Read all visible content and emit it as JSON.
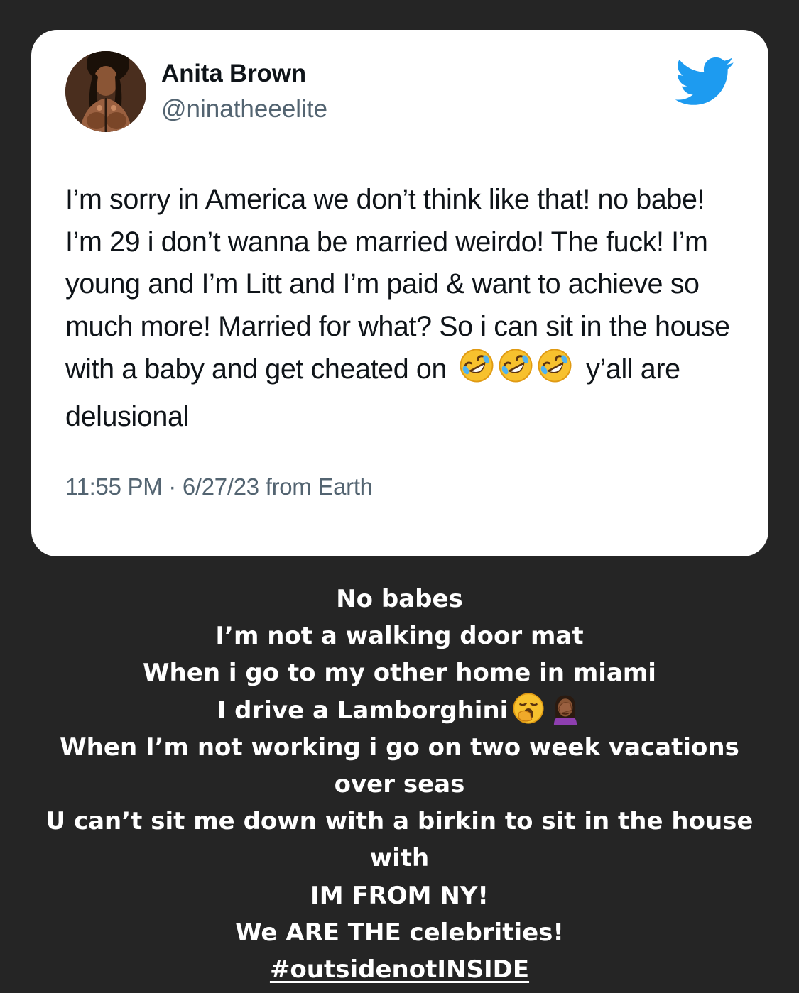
{
  "tweet": {
    "display_name": "Anita Brown",
    "handle": "@ninatheeelite",
    "avatar_icon": "profile-photo",
    "platform_icon": "twitter-bird-icon",
    "platform_color": "#1d9bf0",
    "text_part1": "I’m sorry in America we don’t think like that! no babe! I’m 29 i don’t wanna be married weirdo! The fuck! I’m young and I’m Litt and I’m paid & want to achieve so much more! Married for what? So i can sit in the house with a baby and get cheated on",
    "emoji": "rolling-on-floor-laughing-emoji",
    "emoji_count": 3,
    "text_part2": "y’all are delusional",
    "timestamp": "11:55 PM · 6/27/23 from Earth"
  },
  "caption": {
    "line1": "No babes",
    "line2": "I’m not a walking door mat",
    "line3": "When i go to my other home in miami",
    "line4": "I drive a Lamborghini",
    "line4_emojis": [
      "yawning-face-emoji",
      "woman-facepalming-emoji"
    ],
    "line5": "When I’m not working i go on two week vacations",
    "line6": "over seas",
    "line7": "U can’t sit me down with a birkin to sit in the house",
    "line8": "with",
    "line9": "IM FROM NY!",
    "line10": "We ARE THE celebrities!",
    "hashtag": "#outsidenotINSIDE"
  },
  "colors": {
    "background": "#252525",
    "card": "#ffffff",
    "primary_text": "#0f1419",
    "secondary_text": "#536471",
    "twitter_blue": "#1d9bf0"
  }
}
